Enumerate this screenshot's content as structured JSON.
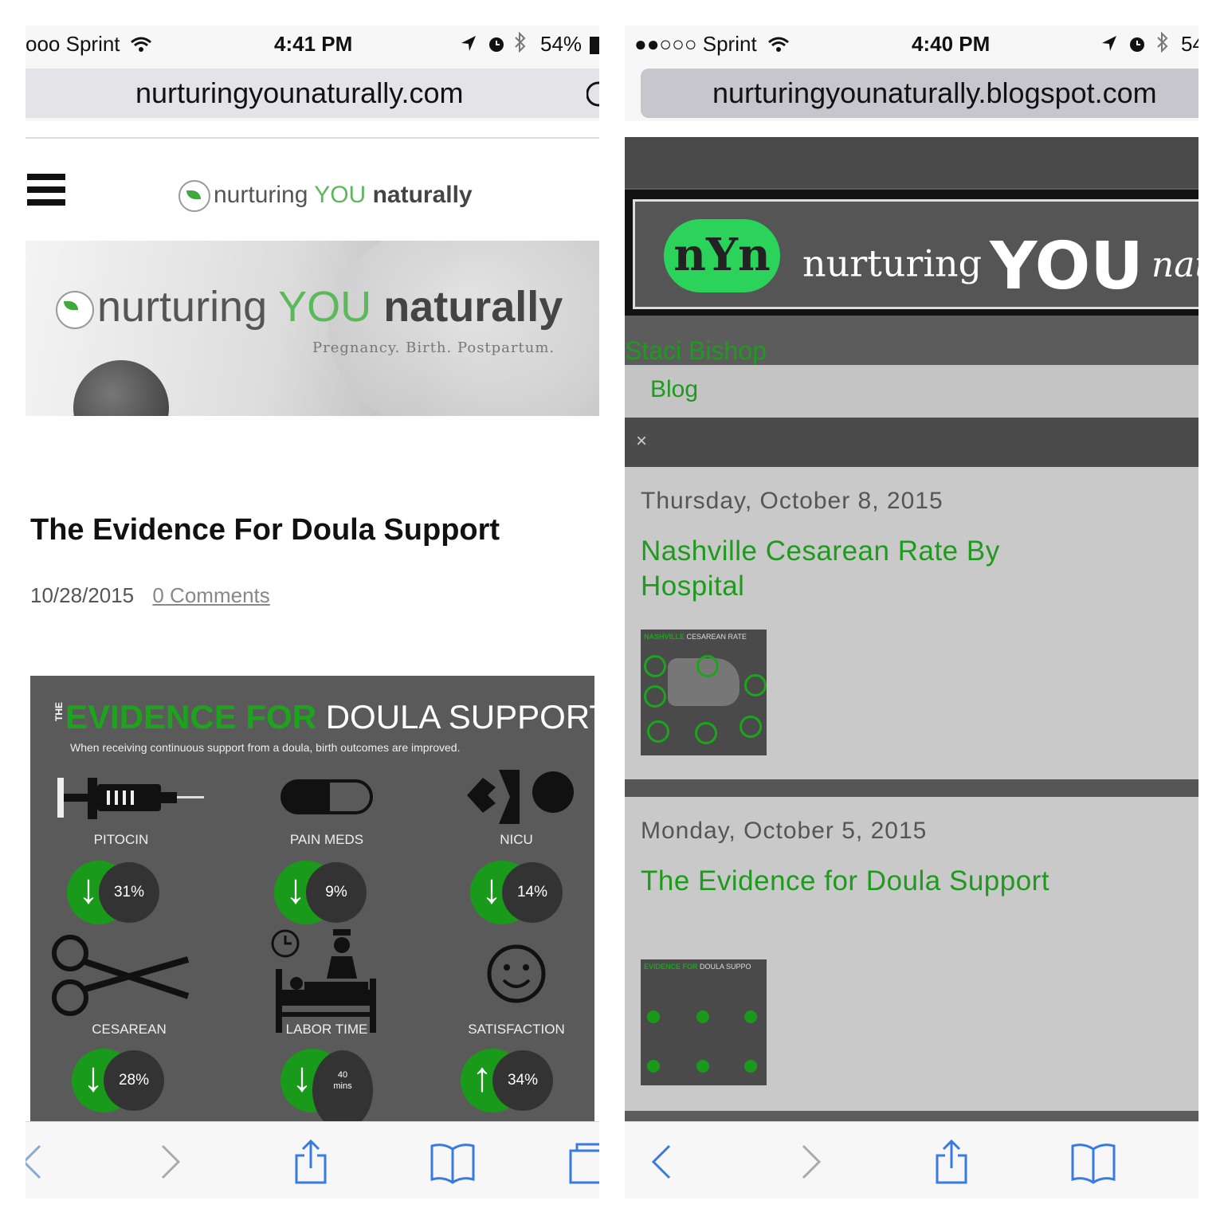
{
  "left": {
    "status": {
      "carrier": "ooo Sprint",
      "time": "4:41 PM",
      "battery": "54%"
    },
    "url": "nurturingyounaturally.com",
    "header": {
      "logo_a": "nurturing ",
      "logo_b": "YOU ",
      "logo_c": "naturally"
    },
    "hero": {
      "logo_a": "nurturing ",
      "logo_b": "YOU ",
      "logo_c": "naturally",
      "tagline": "Pregnancy. Birth. Postpartum."
    },
    "post": {
      "title": "The Evidence For Doula Support",
      "date": "10/28/2015",
      "comments": "0 Comments"
    },
    "infographic": {
      "the": "THE",
      "title_green": "EVIDENCE FOR",
      "title_white": "DOULA SUPPORT",
      "subtitle": "When receiving continuous support from a doula, birth outcomes are improved.",
      "items": [
        {
          "label": "PITOCIN",
          "value": "31%",
          "direction": "down"
        },
        {
          "label": "PAIN MEDS",
          "value": "9%",
          "direction": "down"
        },
        {
          "label": "NICU",
          "value": "14%",
          "direction": "down"
        },
        {
          "label": "CESAREAN",
          "value": "28%",
          "direction": "down"
        },
        {
          "label": "LABOR TIME",
          "value_a": "40",
          "value_b": "mins",
          "direction": "down"
        },
        {
          "label": "SATISFACTION",
          "value": "34%",
          "direction": "up"
        }
      ]
    }
  },
  "right": {
    "status": {
      "carrier": "●●○○○ Sprint",
      "time": "4:40 PM",
      "battery": "54"
    },
    "url": "nurturingyounaturally.blogspot.com",
    "banner": {
      "badge": "nYn",
      "word1": "nurturing",
      "word2": "YOU",
      "word3": "natura"
    },
    "author": "Staci Bishop",
    "nav": "Blog",
    "close": "×",
    "posts": [
      {
        "date": "Thursday, October 8, 2015",
        "title": "Nashville Cesarean Rate By Hospital",
        "thumb_a": "NASHVILLE",
        "thumb_b": " CESAREAN RATE"
      },
      {
        "date": "Monday, October 5, 2015",
        "title": "The Evidence for Doula Support",
        "thumb_a": "EVIDENCE FOR",
        "thumb_b": " DOULA SUPPO"
      }
    ]
  },
  "colors": {
    "accent_green": "#1f9a1f",
    "infographic_bg": "#5a5a5a"
  },
  "icons": [
    "wifi-icon",
    "location-icon",
    "alarm-icon",
    "bluetooth-icon",
    "battery-icon",
    "reload-icon",
    "back-icon",
    "forward-icon",
    "share-icon",
    "bookmarks-icon",
    "tabs-icon",
    "menu-icon"
  ]
}
